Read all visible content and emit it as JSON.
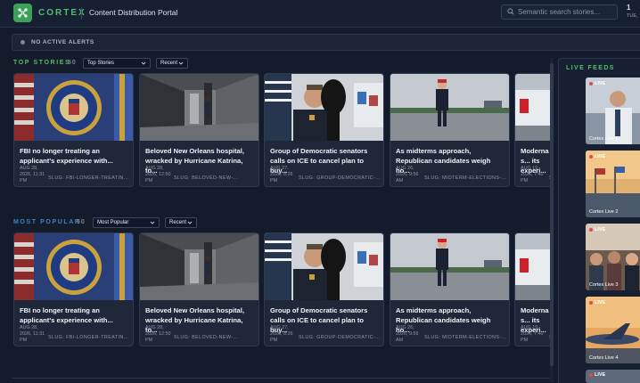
{
  "header": {
    "brand": "CORTEX",
    "portal_title": "Content Distribution Portal",
    "search_placeholder": "Semantic search stories...",
    "clock": "1",
    "clock_date": "TUE,"
  },
  "alerts": {
    "text": "NO ACTIVE ALERTS"
  },
  "top_stories": {
    "title": "TOP STORIES",
    "count": "50",
    "filter": "Top Stories",
    "sort": "Recent"
  },
  "most_popular": {
    "title": "MOST POPULAR",
    "count": "50",
    "filter": "Most Popular",
    "sort": "Recent"
  },
  "cards": [
    {
      "title": "FBI no longer treating an applicant's experience with...",
      "date": "AUG 28, 2026, 11:31 PM",
      "slug": "SLUG: FBI-LONGER-TREATING-..."
    },
    {
      "title": "Beloved New Orleans hospital, wracked by Hurricane Katrina, to...",
      "date": "AUG 28, 2026, 12:50 PM",
      "slug": "SLUG: BELOVED-NEW-..."
    },
    {
      "title": "Group of Democratic senators calls on ICE to cancel plan to buy...",
      "date": "AUG 27, 2026, 8:26 PM",
      "slug": "SLUG: GROUP-DEMOCRATIC-..."
    },
    {
      "title": "As midterms approach, Republican candidates weigh ho...",
      "date": "AUG 26, 2026, 9:56 AM",
      "slug": "SLUG: MIDTERM-ELECTIONS-..."
    },
    {
      "title": "Moderna s... its experi...",
      "date": "AUG 19, 2026, 7:40 PM",
      "slug": "S"
    }
  ],
  "live_feeds": {
    "title": "LIVE FEEDS",
    "live_label": "LIVE",
    "items": [
      "Cortex Live 1",
      "Cortex Live 2",
      "Cortex Live 3",
      "Cortex Live 4",
      "Cortex Live 5"
    ]
  }
}
